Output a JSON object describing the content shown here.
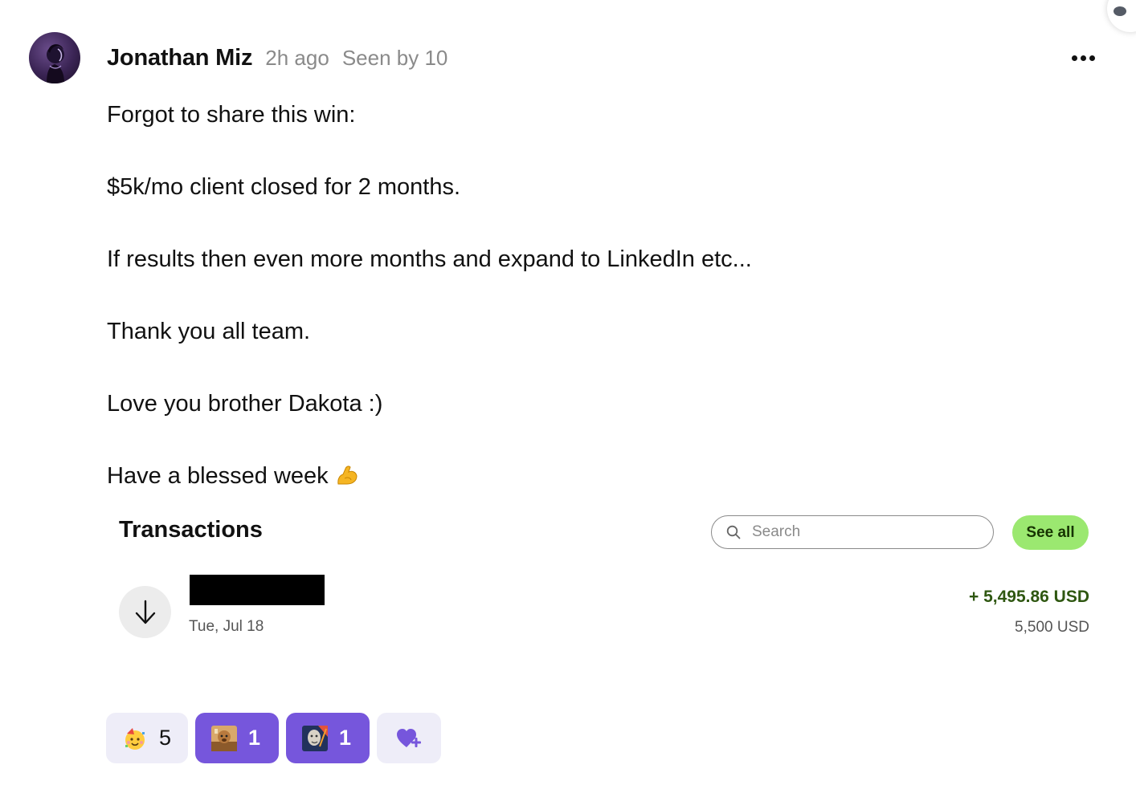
{
  "post": {
    "author": "Jonathan Miz",
    "time": "2h ago",
    "seen": "Seen by 10",
    "body": [
      "Forgot to share this win:",
      "$5k/mo client closed for 2 months.",
      "If results then even more months and expand to LinkedIn etc...",
      "Thank you all team.",
      "Love you brother Dakota :)",
      "Have a blessed week"
    ]
  },
  "icons": {
    "more": "more-horizontal-icon",
    "flexed_biceps": "flexed-biceps-emoji",
    "search": "search-icon",
    "arrow_down": "arrow-down-icon",
    "add_reaction": "heart-plus-icon"
  },
  "transactions": {
    "title": "Transactions",
    "search_placeholder": "Search",
    "see_all": "See all",
    "rows": [
      {
        "date": "Tue, Jul 18",
        "amount": "+ 5,495.86 USD",
        "subamount": "5,500 USD"
      }
    ]
  },
  "reactions": [
    {
      "emoji": "partying-face-emoji",
      "count": "5",
      "active": false
    },
    {
      "emoji": "custom-dog-emoji",
      "count": "1",
      "active": true
    },
    {
      "emoji": "custom-portrait-emoji",
      "count": "1",
      "active": true
    }
  ],
  "colors": {
    "accent": "#7656dc",
    "reaction_bg": "#eeedf8",
    "see_all_bg": "#9be870",
    "amount_green": "#2f5711",
    "meta_gray": "#8a8a8a"
  }
}
